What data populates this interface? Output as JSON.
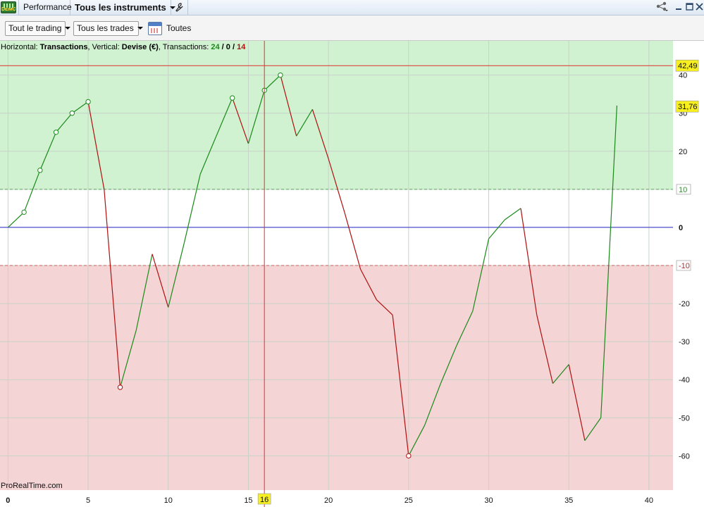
{
  "titlebar": {
    "tab_performance": "Performance",
    "tab_instruments": "Tous les instruments",
    "demo_badge": "DEMO",
    "icons": [
      "wrench-icon",
      "share-icon",
      "minimize-icon",
      "maximize-icon",
      "close-icon"
    ]
  },
  "toolbar": {
    "trading_filter": "Tout le trading",
    "trades_filter": "Tous les trades",
    "period_label": "Toutes",
    "icons": [
      "calendar-icon"
    ]
  },
  "header": {
    "horizontal_label": "Horizontal: ",
    "horizontal_value": "Transactions",
    "vertical_label": ", Vertical: ",
    "vertical_value": "Devise (€)",
    "transactions_label": ", Transactions: ",
    "wins": "24",
    "sep1": " / ",
    "neutral": "0",
    "sep2": " / ",
    "losses": "14"
  },
  "watermark": "ProRealTime.com",
  "colors": {
    "up": "#1a8a1a",
    "down": "#b01010",
    "profit_zone": "#d0f2d0",
    "loss_zone": "#f4d4d4",
    "zero_line": "#2a2ac8",
    "cursor": "#e03030",
    "badge": "#f7ef20"
  },
  "chart_data": {
    "type": "line",
    "xlabel": "",
    "ylabel": "",
    "xlim": [
      -0.5,
      41.5
    ],
    "ylim": [
      -69,
      49
    ],
    "x_ticks": [
      0,
      5,
      10,
      15,
      20,
      25,
      30,
      35,
      40
    ],
    "y_ticks": [
      40,
      30,
      20,
      10,
      0,
      -10,
      -20,
      -30,
      -40,
      -50,
      -60
    ],
    "y_tick_labels": [
      "40",
      "30",
      "20",
      "10",
      "0",
      "-10",
      "-20",
      "-30",
      "-40",
      "-50",
      "-60"
    ],
    "x_tick_labels": [
      "0",
      "5",
      "10",
      "15",
      "20",
      "25",
      "30",
      "35",
      "40"
    ],
    "grid": true,
    "profit_zone_from": 10,
    "loss_zone_from": -10,
    "x": [
      0,
      1,
      2,
      3,
      4,
      5,
      6,
      7,
      8,
      9,
      10,
      11,
      12,
      13,
      14,
      15,
      16,
      17,
      18,
      19,
      20,
      21,
      22,
      23,
      24,
      25,
      26,
      27,
      28,
      29,
      30,
      31,
      32,
      33,
      34,
      35,
      36,
      37,
      38
    ],
    "values": [
      0,
      4,
      15,
      25,
      30,
      33,
      10,
      -42,
      -27,
      -7,
      -21,
      -4,
      14,
      24,
      34,
      22,
      36,
      40,
      24,
      31,
      18,
      4,
      -11,
      -19,
      -23,
      -60,
      -52,
      -41,
      -31,
      -22,
      -3,
      2,
      5,
      -23,
      -41,
      -36,
      -56,
      -50,
      32
    ],
    "highlight_markers": [
      1,
      2,
      3,
      4,
      5,
      7,
      14,
      16,
      17,
      25
    ],
    "cursor": {
      "x": 16,
      "x_label": "16",
      "y": 42.49,
      "y_label": "42,49"
    },
    "last_value": {
      "y": 31.76,
      "label": "31,76"
    }
  }
}
